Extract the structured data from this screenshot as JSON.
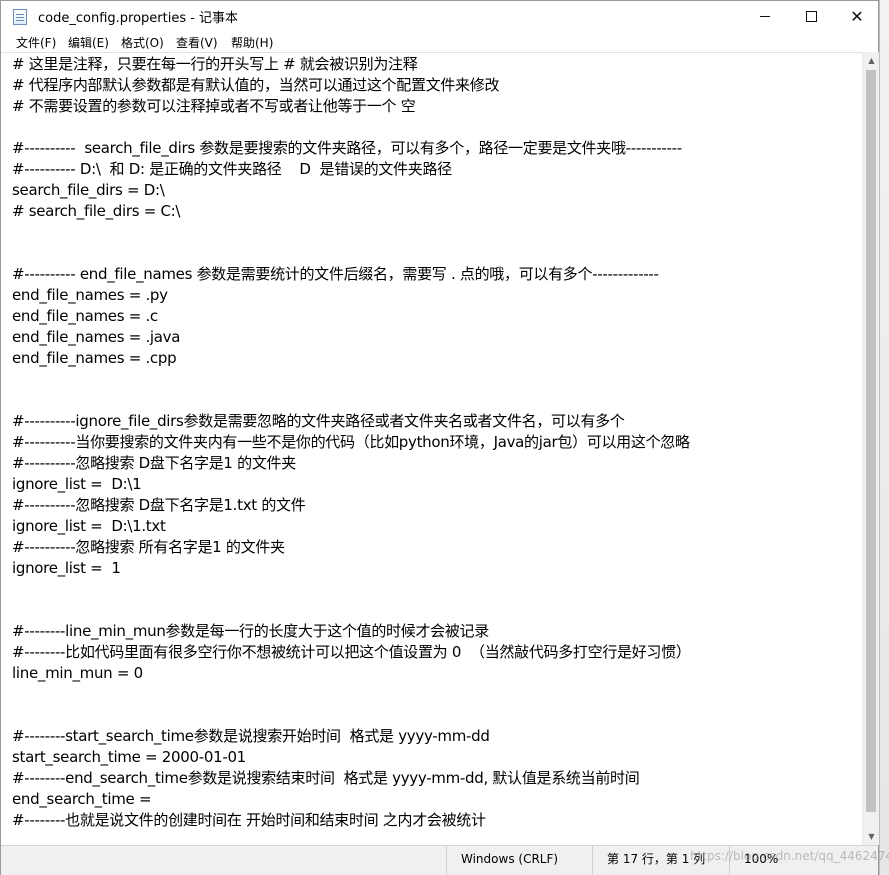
{
  "window": {
    "title": "code_config.properties - 记事本",
    "minimize_icon": "minimize-icon",
    "maximize_icon": "maximize-icon",
    "close_icon": "close-icon",
    "close_glyph": "✕"
  },
  "menu": {
    "file": "文件(F)",
    "edit": "编辑(E)",
    "format": "格式(O)",
    "view": "查看(V)",
    "help": "帮助(H)"
  },
  "editor": {
    "lines": [
      "# 这里是注释，只要在每一行的开头写上 # 就会被识别为注释",
      "# 代程序内部默认参数都是有默认值的，当然可以通过这个配置文件来修改",
      "# 不需要设置的参数可以注释掉或者不写或者让他等于一个 空",
      "",
      "#----------  search_file_dirs 参数是要搜索的文件夹路径，可以有多个，路径一定要是文件夹哦-----------",
      "#---------- D:\\  和 D: 是正确的文件夹路径    D  是错误的文件夹路径",
      "search_file_dirs = D:\\",
      "# search_file_dirs = C:\\",
      "",
      "",
      "#---------- end_file_names 参数是需要统计的文件后缀名，需要写 . 点的哦，可以有多个-------------",
      "end_file_names = .py",
      "end_file_names = .c",
      "end_file_names = .java",
      "end_file_names = .cpp",
      "",
      "",
      "#----------ignore_file_dirs参数是需要忽略的文件夹路径或者文件夹名或者文件名，可以有多个",
      "#----------当你要搜索的文件夹内有一些不是你的代码（比如python环境，Java的jar包）可以用这个忽略",
      "#----------忽略搜索 D盘下名字是1 的文件夹",
      "ignore_list =  D:\\1",
      "#----------忽略搜索 D盘下名字是1.txt 的文件",
      "ignore_list =  D:\\1.txt",
      "#----------忽略搜索 所有名字是1 的文件夹",
      "ignore_list =  1",
      "",
      "",
      "#--------line_min_mun参数是每一行的长度大于这个值的时候才会被记录",
      "#--------比如代码里面有很多空行你不想被统计可以把这个值设置为 0  （当然敲代码多打空行是好习惯）",
      "line_min_mun = 0",
      "",
      "",
      "#--------start_search_time参数是说搜索开始时间  格式是 yyyy-mm-dd",
      "start_search_time = 2000-01-01",
      "#--------end_search_time参数是说搜索结束时间  格式是 yyyy-mm-dd, 默认值是系统当前时间",
      "end_search_time =",
      "#--------也就是说文件的创建时间在 开始时间和结束时间 之内才会被统计"
    ]
  },
  "scrollbar": {
    "up_icon": "scroll-up-arrow-icon",
    "down_icon": "scroll-down-arrow-icon",
    "up_glyph": "▲",
    "down_glyph": "▼"
  },
  "status": {
    "encoding": "Windows (CRLF)",
    "position": "第 17 行，第 1 列",
    "zoom": "100%"
  },
  "watermark": "https://blog.csdn.net/qq_44624742"
}
